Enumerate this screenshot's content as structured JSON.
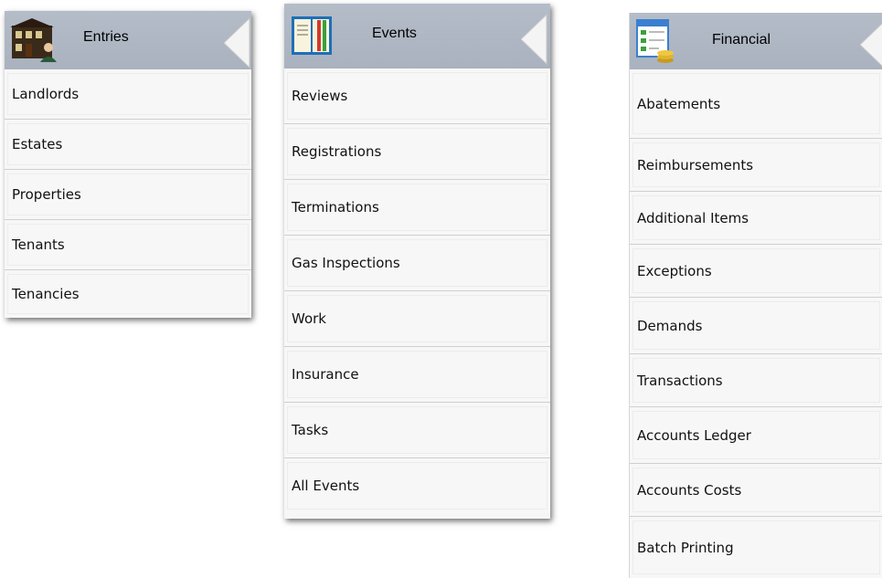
{
  "entries": {
    "title": "Entries",
    "icon": "houses-person-icon",
    "items": [
      {
        "label": "Landlords"
      },
      {
        "label": "Estates"
      },
      {
        "label": "Properties"
      },
      {
        "label": "Tenants"
      },
      {
        "label": "Tenancies"
      }
    ]
  },
  "events": {
    "title": "Events",
    "icon": "calendar-book-icon",
    "items": [
      {
        "label": "Reviews"
      },
      {
        "label": "Registrations"
      },
      {
        "label": "Terminations"
      },
      {
        "label": "Gas Inspections"
      },
      {
        "label": "Work"
      },
      {
        "label": "Insurance"
      },
      {
        "label": "Tasks"
      },
      {
        "label": "All Events"
      }
    ]
  },
  "financial": {
    "title": "Financial",
    "icon": "ledger-coins-icon",
    "items": [
      {
        "label": "Abatements"
      },
      {
        "label": "Reimbursements"
      },
      {
        "label": "Additional Items"
      },
      {
        "label": "Exceptions"
      },
      {
        "label": "Demands"
      },
      {
        "label": "Transactions"
      },
      {
        "label": "Accounts Ledger"
      },
      {
        "label": "Accounts Costs"
      },
      {
        "label": "Batch Printing"
      }
    ]
  },
  "colors": {
    "header_bg": "#adb5c1",
    "item_bg": "#f7f7f7",
    "divider": "#cfcfcf"
  }
}
